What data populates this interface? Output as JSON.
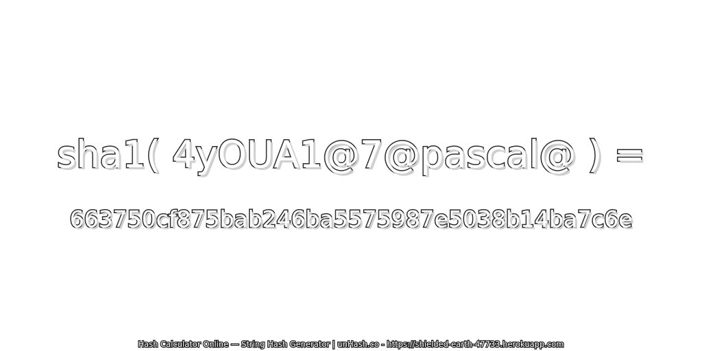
{
  "expression": "sha1( 4yOUA1@7@pascal@ ) =",
  "hash": "663750cf875bab246ba5575987e5038b14ba7c6e",
  "footer": "Hash Calculator Online — String Hash Generator | unHash.co - https://shielded-earth-47733.herokuapp.com",
  "colors": {
    "background": "#ffffff",
    "text_fill": "#ffffff",
    "text_outline": "#2a2a2a",
    "shadow": "#cfcfcf"
  }
}
